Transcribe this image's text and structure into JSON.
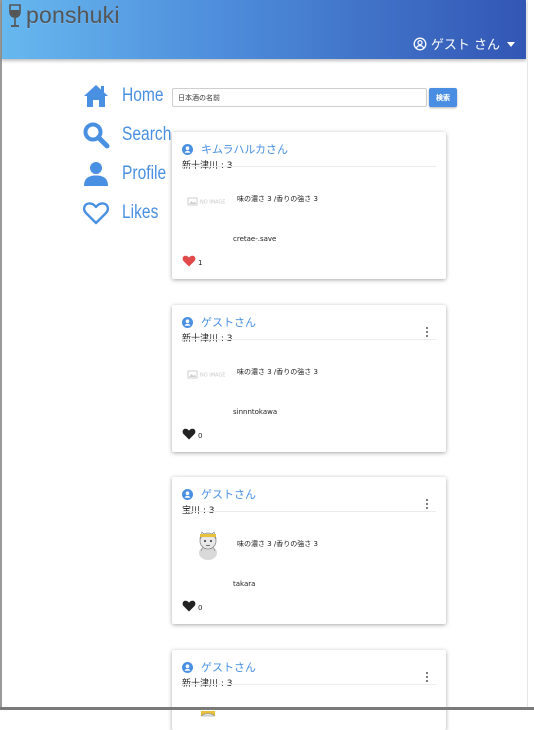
{
  "app": {
    "title": "ponshuki"
  },
  "header": {
    "user_label": "ゲスト さん"
  },
  "nav": [
    {
      "label": "Home",
      "icon": "home-icon"
    },
    {
      "label": "Search",
      "icon": "search-icon"
    },
    {
      "label": "Profile",
      "icon": "profile-icon"
    },
    {
      "label": "Likes",
      "icon": "heart-outline-icon"
    }
  ],
  "search": {
    "placeholder": "日本酒の名前",
    "button_label": "検索"
  },
  "noimage_text": "NO IMAGE",
  "posts": [
    {
      "user": "キムラハルカさん",
      "sake": "新十津川 : 3",
      "detail": "味の濃さ 3 /香りの強さ 3",
      "comment": "cretae-.save",
      "likes": "1",
      "liked": true,
      "has_menu": false,
      "image": "no-image"
    },
    {
      "user": "ゲストさん",
      "sake": "新十津川 : 3",
      "detail": "味の濃さ 3 /香りの強さ 3",
      "comment": "sinnntokawa",
      "likes": "0",
      "liked": false,
      "has_menu": true,
      "image": "no-image"
    },
    {
      "user": "ゲストさん",
      "sake": "宝川 : 3",
      "detail": "味の濃さ 3 /香りの強さ 3",
      "comment": "takara",
      "likes": "0",
      "liked": false,
      "has_menu": true,
      "image": "cat-illustration"
    },
    {
      "user": "ゲストさん",
      "sake": "新十津川 : 3",
      "detail": "",
      "comment": "",
      "likes": "",
      "liked": false,
      "has_menu": true,
      "image": "cat-illustration"
    }
  ],
  "colors": {
    "accent": "#4a90e2",
    "liked": "#e04a4a",
    "header_start": "#67b8ef",
    "header_end": "#3256b4"
  }
}
